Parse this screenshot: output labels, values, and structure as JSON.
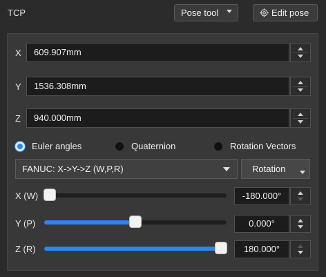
{
  "header": {
    "title": "TCP",
    "pose_tool_label": "Pose tool",
    "edit_pose_label": "Edit pose"
  },
  "position": {
    "x": {
      "label": "X",
      "value": "609.907mm"
    },
    "y": {
      "label": "Y",
      "value": "1536.308mm"
    },
    "z": {
      "label": "Z",
      "value": "940.000mm"
    }
  },
  "orientation_modes": [
    {
      "label": "Euler angles",
      "selected": true
    },
    {
      "label": "Quaternion",
      "selected": false
    },
    {
      "label": "Rotation Vectors",
      "selected": false
    }
  ],
  "euler": {
    "convention": "FANUC: X->Y->Z (W,P,R)",
    "rotation_label": "Rotation",
    "sliders": [
      {
        "label": "X (W)",
        "value": "-180.000°",
        "level": 0.0
      },
      {
        "label": "Y (P)",
        "value": "0.000°",
        "level": 0.5
      },
      {
        "label": "Z (R)",
        "value": "180.000°",
        "level": 1.0
      }
    ]
  },
  "colors": {
    "accent": "#2f86ea",
    "panel": "#383838",
    "background": "#2b2b2b"
  },
  "icons": {
    "edit_pose": "gear-icon",
    "pose_tool": "chevron-down-icon"
  }
}
